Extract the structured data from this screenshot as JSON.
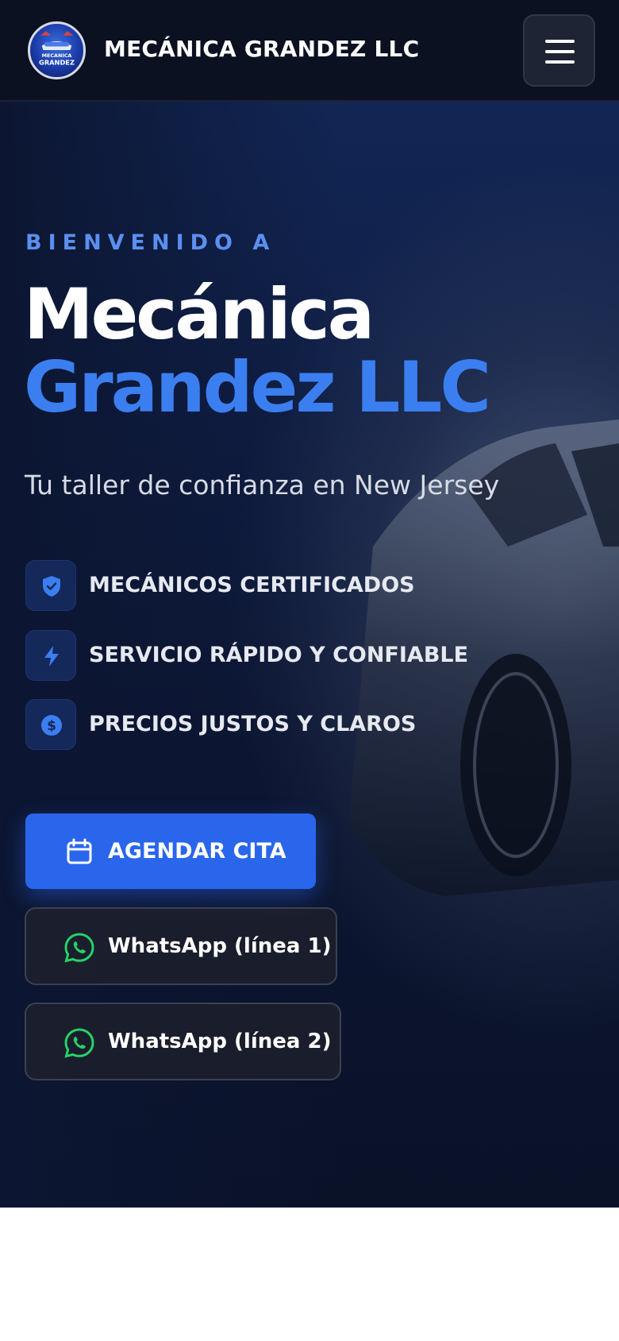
{
  "header": {
    "logo_text_top": "MECANICA",
    "logo_text_bottom": "GRANDEZ",
    "brand_name": "MECÁNICA GRANDEZ LLC",
    "menu_icon": "hamburger-menu-icon"
  },
  "hero": {
    "eyebrow": "BIENVENIDO A",
    "title_line1": "Mecánica",
    "title_line2": "Grandez LLC",
    "subtitle": "Tu taller de confianza en New Jersey",
    "features": [
      {
        "icon": "shield-check-icon",
        "label": "MECÁNICOS CERTIFICADOS"
      },
      {
        "icon": "lightning-bolt-icon",
        "label": "SERVICIO RÁPIDO Y CONFIABLE"
      },
      {
        "icon": "dollar-coin-icon",
        "label": "PRECIOS JUSTOS Y CLAROS"
      }
    ],
    "cta_primary": {
      "icon": "calendar-icon",
      "label": "AGENDAR CITA"
    },
    "whatsapp_buttons": [
      {
        "icon": "whatsapp-icon",
        "label": "WhatsApp (línea 1)"
      },
      {
        "icon": "whatsapp-icon",
        "label": "WhatsApp (línea 2)"
      }
    ]
  },
  "colors": {
    "header_bg": "#0b1120",
    "accent_blue": "#3b7ef0",
    "eyebrow_blue": "#5b8ff0",
    "primary_button": "#2a66ec",
    "whatsapp_green": "#25d366"
  }
}
